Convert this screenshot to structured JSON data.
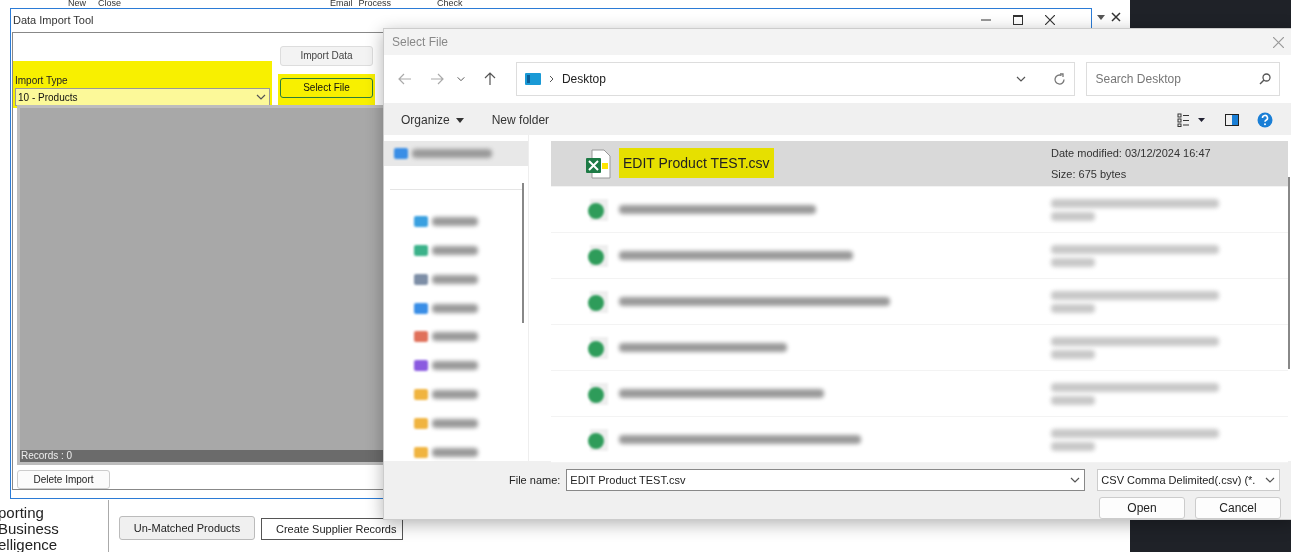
{
  "background_app": {
    "top_labels": [
      "New",
      "Close",
      "Email",
      "Process",
      "Check"
    ],
    "logo_lines": [
      "porting",
      "Business",
      "elligence"
    ],
    "buttons": [
      "Un-Matched Products",
      "Create Supplier Records"
    ]
  },
  "import_window": {
    "title": "Data Import Tool",
    "import_type_label": "Import Type",
    "import_type_value": "10 - Products",
    "import_type_highlighted": true,
    "buttons": [
      {
        "label": "Import Data",
        "highlighted": false,
        "focused": false
      },
      {
        "label": "Select File",
        "highlighted": true,
        "focused": true
      }
    ],
    "records_label": "Records : 0",
    "delete_button": "Delete Import"
  },
  "file_dialog": {
    "title": "Select File",
    "location": "Desktop",
    "search_placeholder": "Search Desktop",
    "toolbar": [
      "Organize",
      "New folder"
    ],
    "navigation_pane": [
      {
        "kind": "blurred",
        "color": "#3a8ee6"
      },
      {
        "kind": "divider"
      },
      {
        "kind": "blurred",
        "color": "#3aa0e0"
      },
      {
        "kind": "blurred",
        "color": "#3bb28a"
      },
      {
        "kind": "blurred",
        "color": "#7d8ea6"
      },
      {
        "kind": "blurred",
        "color": "#3a8ee6"
      },
      {
        "kind": "blurred",
        "color": "#e0705a"
      },
      {
        "kind": "blurred",
        "color": "#8a5ae0"
      },
      {
        "kind": "blurred",
        "color": "#f0b440"
      },
      {
        "kind": "blurred",
        "color": "#f0b440"
      },
      {
        "kind": "blurred",
        "color": "#f0b440"
      }
    ],
    "files": [
      {
        "kind": "file",
        "name": "EDIT Product TEST.csv",
        "date_modified": "Date modified: 03/12/2024 16:47",
        "size": "Size: 675 bytes",
        "selected": true,
        "highlighted": true
      },
      {
        "kind": "blurred",
        "selected": false
      },
      {
        "kind": "blurred",
        "selected": false
      },
      {
        "kind": "blurred",
        "selected": false
      },
      {
        "kind": "blurred",
        "selected": false
      },
      {
        "kind": "blurred",
        "selected": false
      },
      {
        "kind": "blurred",
        "selected": false
      }
    ],
    "file_name_label": "File name:",
    "file_name_value": "EDIT Product TEST.csv",
    "file_type": "CSV Comma Delimited(.csv) (*.",
    "buttons": [
      "Open",
      "Cancel"
    ]
  }
}
